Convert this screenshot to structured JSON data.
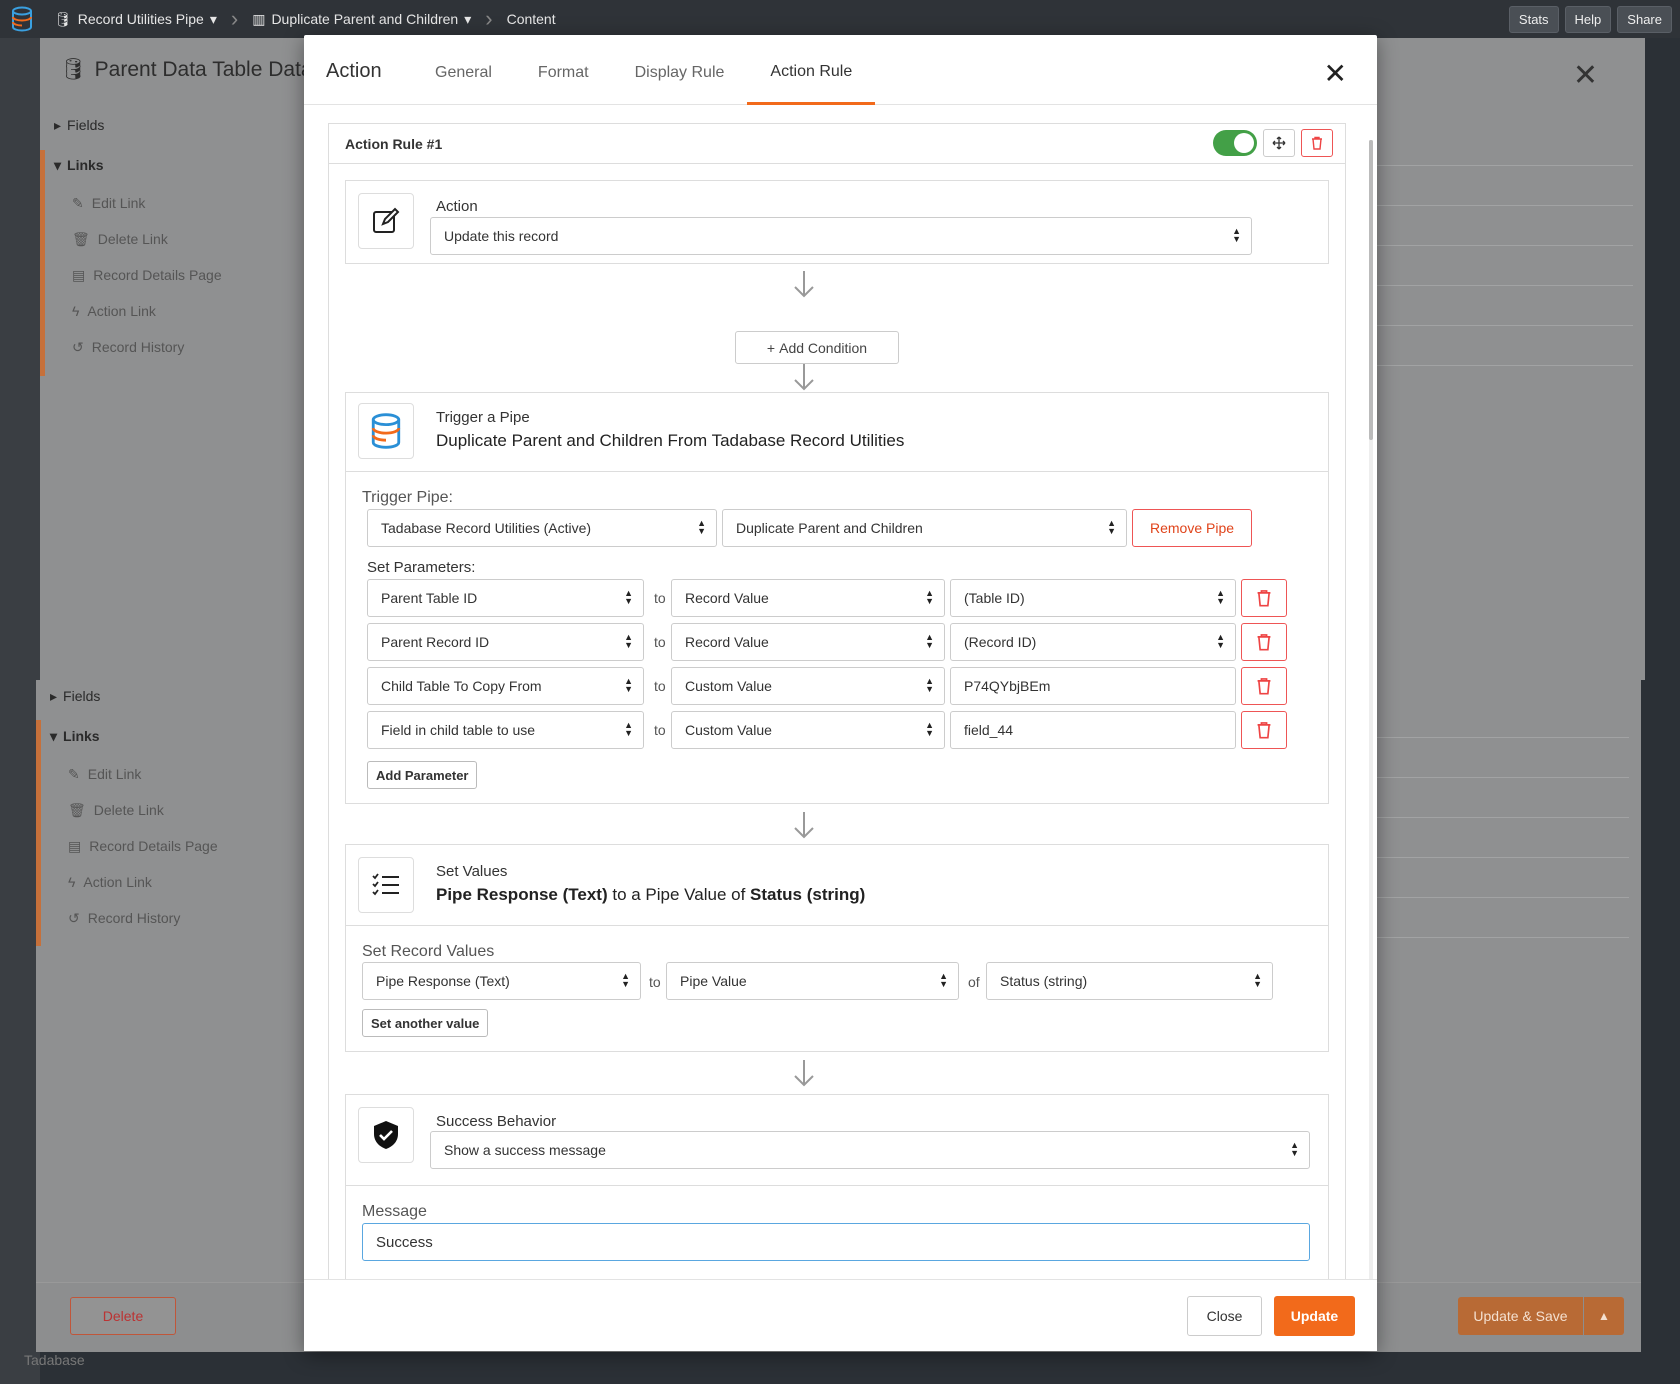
{
  "topbar": {
    "crumb1": "Record Utilities Pipe",
    "crumb2": "Duplicate Parent and Children",
    "crumb3": "Content",
    "stats": "Stats",
    "help": "Help",
    "share": "Share"
  },
  "background": {
    "title": "Parent Data Table Data Ta",
    "fields_label": "Fields",
    "links_label": "Links",
    "links": [
      "Edit Link",
      "Delete Link",
      "Record Details Page",
      "Action Link",
      "Record History"
    ],
    "delete_btn": "Delete",
    "update_save_btn": "Update & Save",
    "footer_brand": "Tadabase"
  },
  "modal": {
    "title": "Action",
    "tabs": [
      "General",
      "Format",
      "Display Rule",
      "Action Rule"
    ],
    "active_tab": "Action Rule",
    "rule": {
      "title": "Action Rule #1",
      "enabled": true,
      "action_label": "Action",
      "action_value": "Update this record",
      "add_condition": "Add Condition",
      "pipe": {
        "label": "Trigger a Pipe",
        "description": "Duplicate Parent and Children From Tadabase Record Utilities",
        "trigger_label": "Trigger Pipe:",
        "pipe_select": "Tadabase Record Utilities (Active)",
        "pipe_action_select": "Duplicate Parent and Children",
        "remove_pipe": "Remove Pipe",
        "params_label": "Set Parameters:",
        "to": "to",
        "params": [
          {
            "field": "Parent Table ID",
            "source": "Record Value",
            "value": "(Table ID)"
          },
          {
            "field": "Parent Record ID",
            "source": "Record Value",
            "value": "(Record ID)"
          },
          {
            "field": "Child Table To Copy From",
            "source": "Custom Value",
            "value": "P74QYbjBEm"
          },
          {
            "field": "Field in child table to use",
            "source": "Custom Value",
            "value": "field_44"
          }
        ],
        "add_parameter": "Add Parameter"
      },
      "set_values": {
        "label": "Set Values",
        "desc_bold1": "Pipe Response (Text)",
        "desc_mid": " to a Pipe Value of ",
        "desc_bold2": "Status (string)",
        "section_label": "Set Record Values",
        "field": "Pipe Response (Text)",
        "to": "to",
        "source": "Pipe Value",
        "of": "of",
        "value": "Status (string)",
        "another": "Set another value"
      },
      "success": {
        "label": "Success Behavior",
        "value": "Show a success message",
        "message_label": "Message",
        "message": "Success"
      }
    },
    "close_btn": "Close",
    "update_btn": "Update"
  },
  "colors": {
    "accent": "#f26a1b",
    "toggle_on": "#43a047",
    "danger": "#e55555"
  }
}
